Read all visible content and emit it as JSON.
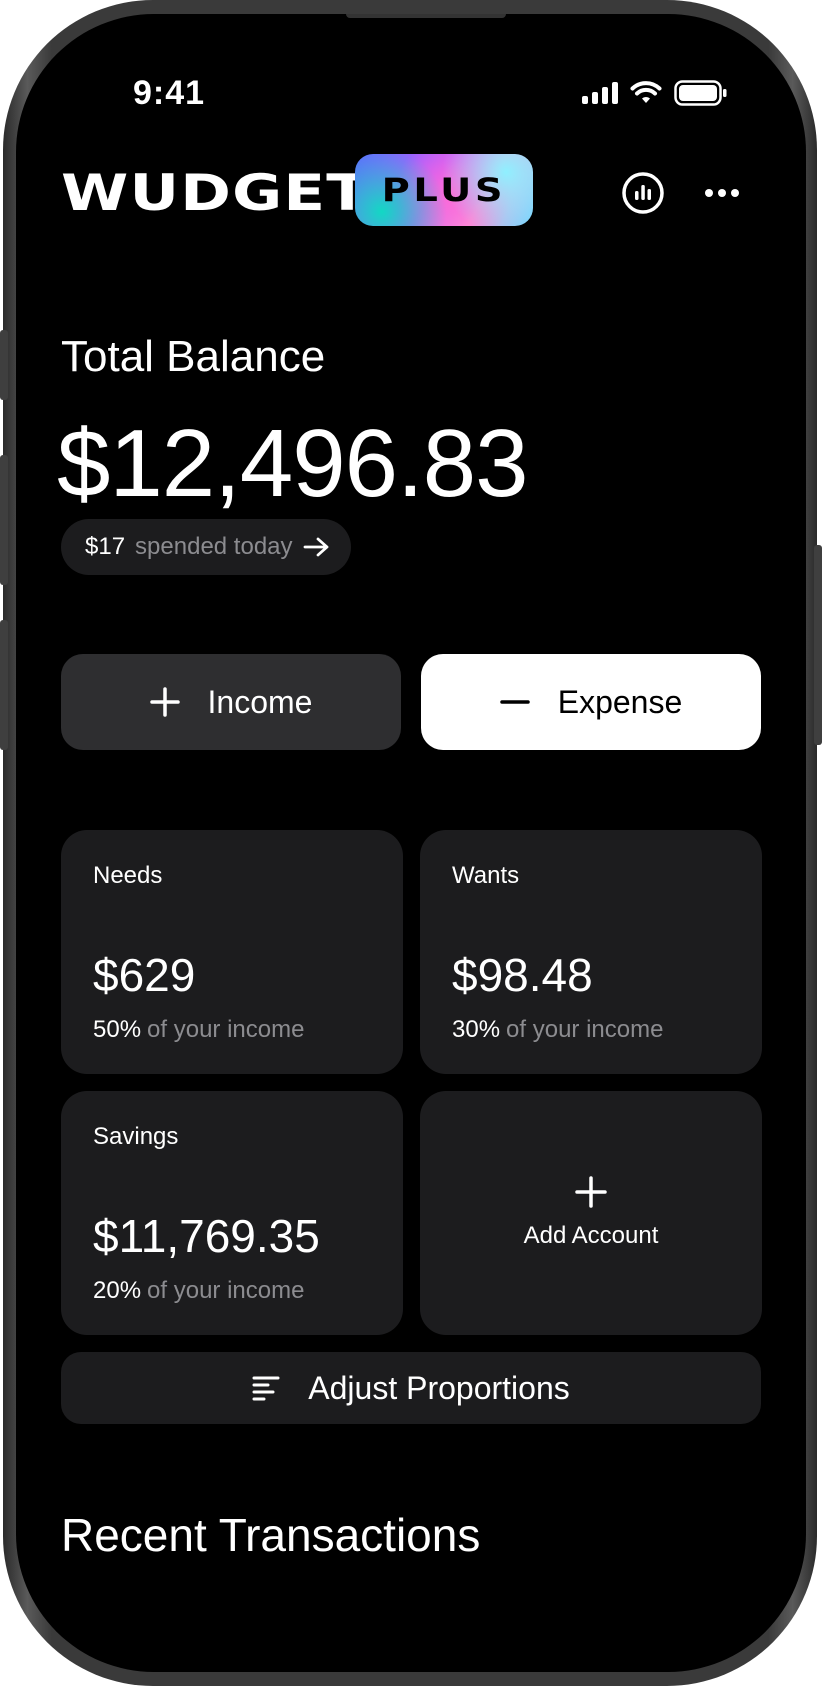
{
  "status_bar": {
    "time": "9:41"
  },
  "header": {
    "brand": "WUDGET",
    "badge": "PLUS",
    "icons": {
      "stats": "bar-chart-circle-icon",
      "more": "ellipsis-icon"
    }
  },
  "balance": {
    "label": "Total Balance",
    "amount": "$12,496.83",
    "spent_amount": "$17",
    "spent_label": "spended today"
  },
  "actions": {
    "income_label": "Income",
    "expense_label": "Expense"
  },
  "accounts": [
    {
      "title": "Needs",
      "amount": "$629",
      "percent": "50%",
      "note": "of your income"
    },
    {
      "title": "Wants",
      "amount": "$98.48",
      "percent": "30%",
      "note": "of your income"
    },
    {
      "title": "Savings",
      "amount": "$11,769.35",
      "percent": "20%",
      "note": "of your income"
    }
  ],
  "add_account_label": "Add Account",
  "adjust_label": "Adjust Proportions",
  "recent_title": "Recent Transactions",
  "colors": {
    "background": "#000000",
    "card": "#1c1c1e",
    "income_button": "#2e2e30",
    "expense_button": "#ffffff",
    "muted_text": "#8c8c90"
  }
}
